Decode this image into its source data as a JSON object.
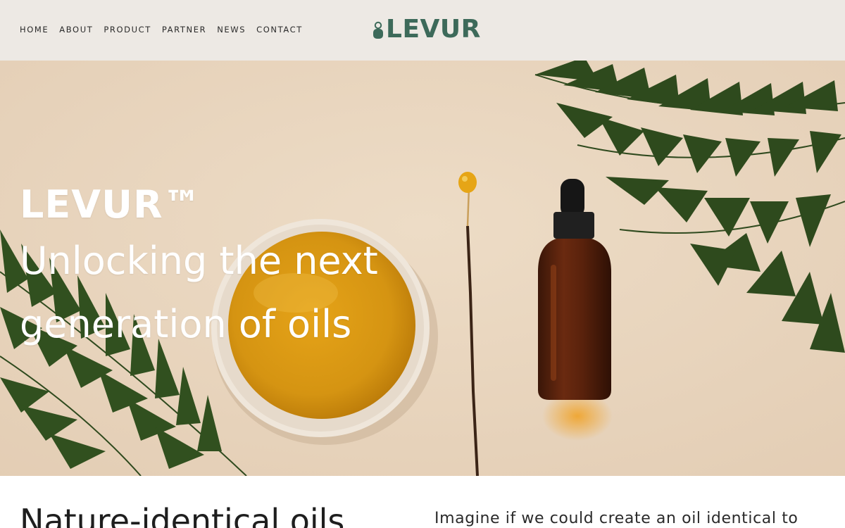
{
  "nav": {
    "links": [
      "HOME",
      "ABOUT",
      "PRODUCT",
      "PARTNER",
      "NEWS",
      "CONTACT"
    ]
  },
  "logo": {
    "text": "LEVUR",
    "icon": "oil-drop-icon",
    "color": "#3d6a5a"
  },
  "hero": {
    "brand": "LEVUR™",
    "tagline": "Unlocking the next generation of oils",
    "image": "oil-bowl-dropper-bottle-palm-leaves"
  },
  "intro": {
    "heading": "Nature-identical oils",
    "body": "Imagine if we could create an oil identical to"
  },
  "colors": {
    "header_bg": "#ede9e4",
    "hero_bg": "#ead7c1",
    "brand_green": "#3d6a5a"
  }
}
